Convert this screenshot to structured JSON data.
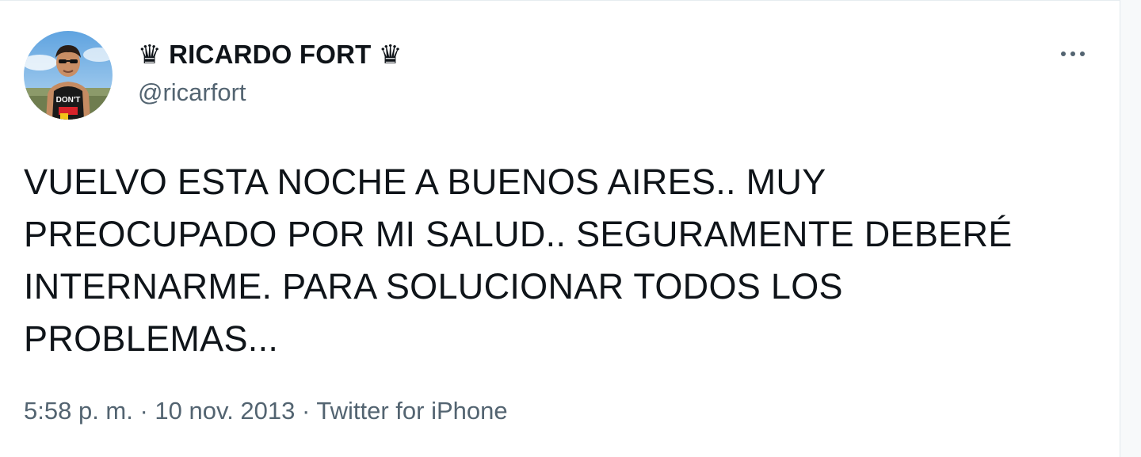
{
  "tweet": {
    "display_name": "♛ RICARDO FORT ♛",
    "handle": "@ricarfort",
    "text": "VUELVO ESTA NOCHE A BUENOS AIRES.. MUY\nPREOCUPADO POR MI SALUD.. SEGURAMENTE DEBERÉ\nINTERNARME. PARA SOLUCIONAR TODOS LOS\nPROBLEMAS...",
    "time": "5:58 p. m.",
    "separator": " · ",
    "date": "10 nov. 2013",
    "source": "Twitter for iPhone",
    "more_icon": "more-horizontal-icon",
    "avatar_shirt_text": "DON'T"
  },
  "colors": {
    "text_primary": "#0f1419",
    "text_secondary": "#536471",
    "border": "#e1e8ed"
  }
}
